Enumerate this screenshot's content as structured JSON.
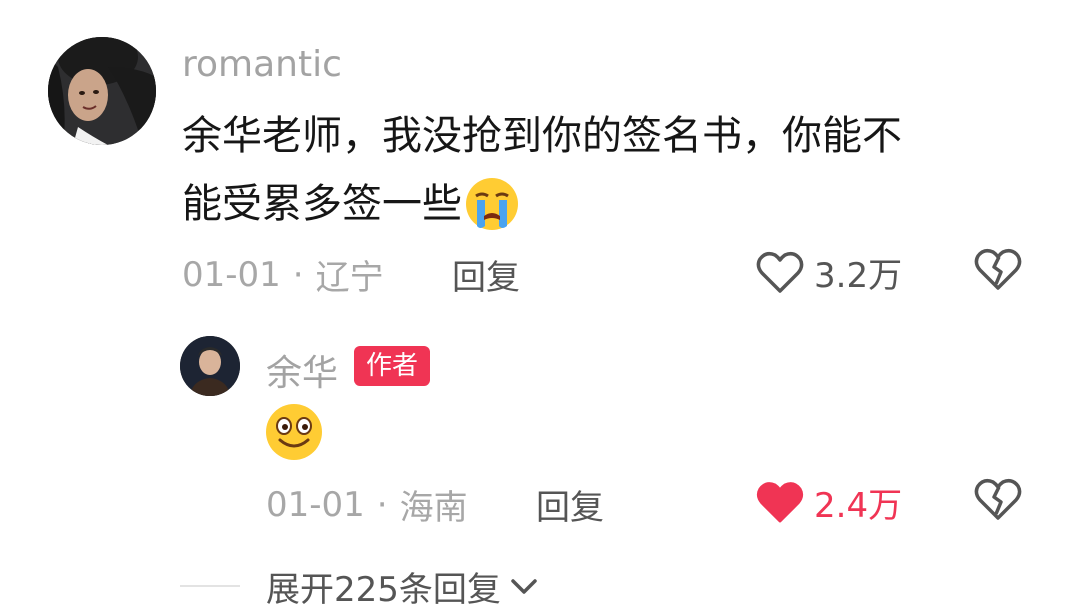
{
  "comment": {
    "username": "romantic",
    "text_line1": "余华老师，我没抢到你的签名书，你能不",
    "text_line2": "能受累多签一些",
    "emoji": "loudly-crying-face",
    "date": "01-01",
    "separator": "·",
    "location": "辽宁",
    "reply_label": "回复",
    "like_count": "3.2万",
    "liked": false
  },
  "reply": {
    "username": "余华",
    "author_badge": "作者",
    "emoji": "grinning-face",
    "date": "01-01",
    "separator": "·",
    "location": "海南",
    "reply_label": "回复",
    "like_count": "2.4万",
    "liked": true
  },
  "expand": {
    "label": "展开225条回复"
  },
  "colors": {
    "liked": "#f03454",
    "muted": "#a7a7a7",
    "text": "#161616"
  }
}
